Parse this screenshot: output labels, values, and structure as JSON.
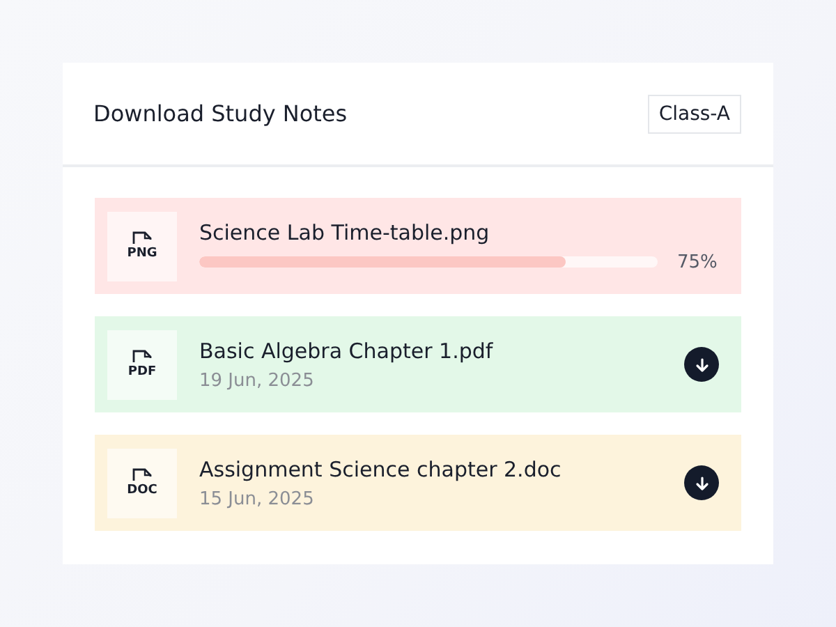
{
  "card": {
    "title": "Download Study Notes",
    "class_badge": "Class-A"
  },
  "files": [
    {
      "kind": "progress",
      "type_label": "PNG",
      "name": "Science Lab Time-table.png",
      "level": 0.8,
      "percent": "75%",
      "color": "#ffe6e6"
    },
    {
      "kind": "download",
      "type_label": "PDF",
      "name": "Basic Algebra Chapter 1.pdf",
      "date": "19 Jun, 2025",
      "color": "#e3f8e8"
    },
    {
      "kind": "download",
      "type_label": "DOC",
      "name": "Assignment Science chapter 2.doc",
      "date": "15 Jun, 2025",
      "color": "#fdf3dc"
    }
  ]
}
